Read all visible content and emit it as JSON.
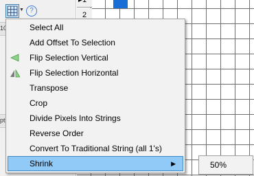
{
  "row_labels": [
    "1",
    "2"
  ],
  "left_strip_labels": [
    "10",
    "pt"
  ],
  "menu": {
    "items": [
      {
        "label": "Select All"
      },
      {
        "label": "Add Offset To Selection"
      },
      {
        "label": "Flip Selection Vertical",
        "icon": "flip-vertical-icon"
      },
      {
        "label": "Flip Selection Horizontal",
        "icon": "flip-horizontal-icon"
      },
      {
        "label": "Transpose"
      },
      {
        "label": "Crop"
      },
      {
        "label": "Divide Pixels Into Strings"
      },
      {
        "label": "Reverse Order"
      },
      {
        "label": "Convert To Traditional String (all 1's)"
      },
      {
        "label": "Shrink",
        "highlighted": true,
        "has_submenu": true
      }
    ]
  },
  "submenu": {
    "items": [
      {
        "label": "50%"
      }
    ]
  },
  "colors": {
    "selection": "#1a6fd6",
    "menu_highlight": "#91c9f7"
  }
}
